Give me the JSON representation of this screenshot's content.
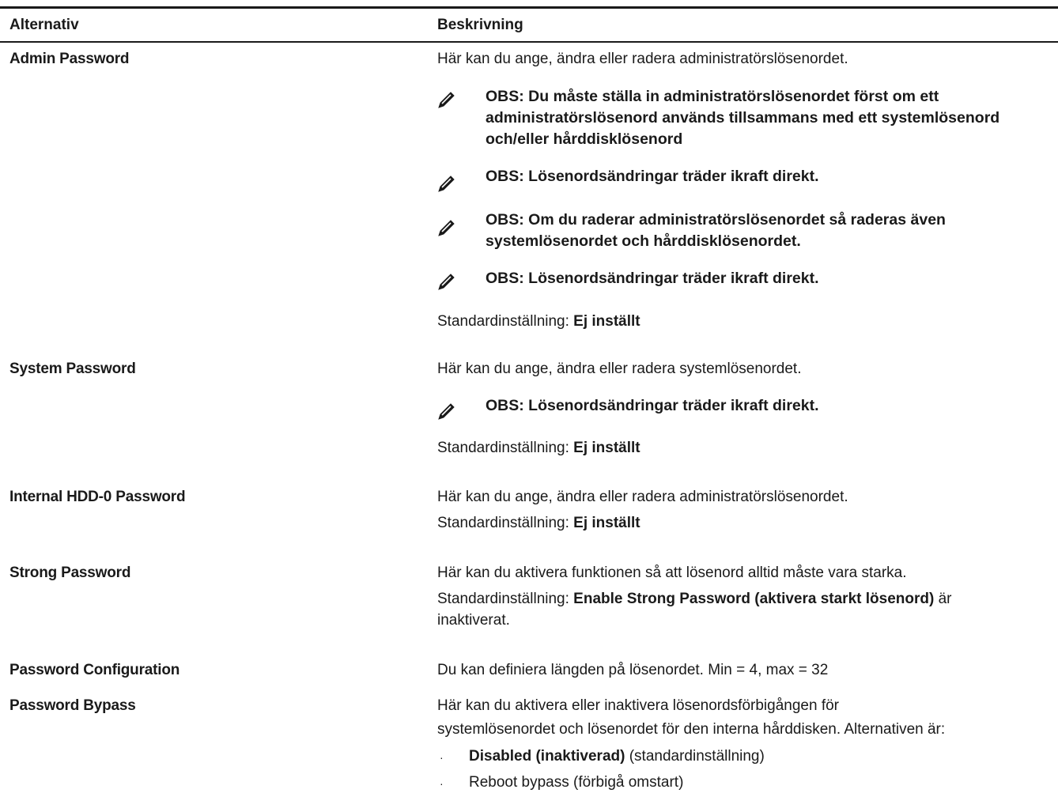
{
  "header": {
    "option": "Alternativ",
    "description": "Beskrivning"
  },
  "default_label": "Standardinställning:",
  "not_set": "Ej inställt",
  "rows": {
    "admin": {
      "name": "Admin Password",
      "desc": "Här kan du ange, ändra eller radera administratörslösenordet.",
      "notes": [
        [
          "OBS: Du måste ställa in administratörslösenordet först om ett",
          "administratörslösenord används tillsammans med ett systemlösenord",
          "och/eller hårddisklösenord"
        ],
        [
          "OBS: Lösenordsändringar träder ikraft direkt."
        ],
        [
          "OBS: Om du raderar administratörslösenordet så raderas även",
          "systemlösenordet och hårddisklösenordet."
        ],
        [
          "OBS: Lösenordsändringar träder ikraft direkt."
        ]
      ]
    },
    "system": {
      "name": "System Password",
      "desc": "Här kan du ange, ändra eller radera systemlösenordet.",
      "note": "OBS: Lösenordsändringar träder ikraft direkt."
    },
    "hdd": {
      "name": "Internal HDD-0 Password",
      "desc": "Här kan du ange, ändra eller radera administratörslösenordet."
    },
    "strong": {
      "name": "Strong Password",
      "desc": "Här kan du aktivera funktionen så att lösenord alltid måste vara starka.",
      "default_value": "Enable Strong Password (aktivera starkt lösenord)",
      "default_suffix": " är",
      "default_line2": "inaktiverat."
    },
    "config": {
      "name": "Password Configuration",
      "desc": "Du kan definiera längden på lösenordet. Min = 4, max = 32"
    },
    "bypass": {
      "name": "Password Bypass",
      "desc_line1": "Här kan du aktivera eller inaktivera lösenordsförbigången för",
      "desc_line2": "systemlösenordet och lösenordet för den interna hårddisken. Alternativen är:",
      "bullet1_bold": "Disabled (inaktiverad)",
      "bullet1_rest": " (standardinställning)",
      "bullet2": "Reboot bypass (förbigå omstart)"
    }
  },
  "icons": {
    "note": "pencil-note-icon",
    "bullet": "bullet-icon"
  },
  "bullet_char": "·"
}
